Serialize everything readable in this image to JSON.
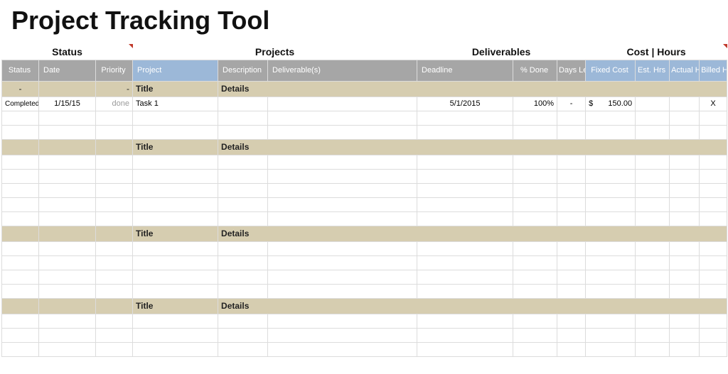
{
  "title": "Project Tracking Tool",
  "groupHeaders": {
    "status": "Status",
    "projects": "Projects",
    "deliverables": "Deliverables",
    "costHours": "Cost | Hours"
  },
  "columns": {
    "status": "Status",
    "date": "Date",
    "priority": "Priority",
    "project": "Project",
    "description": "Description",
    "deliverables": "Deliverable(s)",
    "deadline": "Deadline",
    "pctDone": "% Done",
    "daysLeft": "Days Left",
    "fixedCost": "Fixed Cost",
    "estHrs": "Est. Hrs",
    "actualHrs": "Actual Hrs",
    "billedHrs": "Billed Hrs"
  },
  "sectionLabels": {
    "statusDash": "-",
    "priorityDash": "-",
    "title": "Title",
    "details": "Details"
  },
  "dataRow": {
    "status": "Completed",
    "date": "1/15/15",
    "priority": "done",
    "project": "Task 1",
    "description": "",
    "deliverables": "",
    "deadline": "5/1/2015",
    "pctDone": "100%",
    "daysLeft": "-",
    "fixedCostCurrency": "$",
    "fixedCostValue": "150.00",
    "estHrs": "",
    "actualHrs": "",
    "billedHrs": "X"
  }
}
